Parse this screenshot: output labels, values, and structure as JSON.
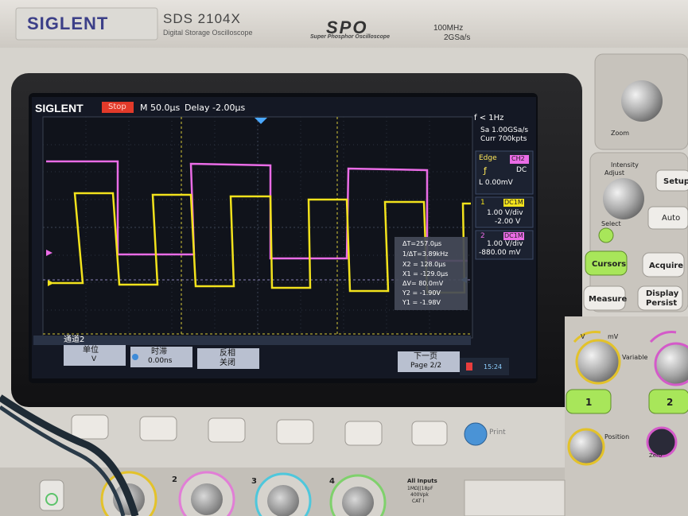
{
  "device": {
    "brand": "SIGLENT",
    "model": "SDS 2104X",
    "model_subtitle": "Digital Storage Oscilloscope",
    "series_logo": "SPO",
    "series_subtitle": "Super Phosphor Oscilloscope",
    "bandwidth": "100MHz",
    "sample_rate": "2GSa/s"
  },
  "screen": {
    "logo": "SIGLENT",
    "run_state": "Stop",
    "timebase": "M 50.0μs",
    "delay": "Delay -2.00μs",
    "freq": "f < 1Hz",
    "sa": "Sa 1.00GSa/s",
    "curr": "Curr 700kpts",
    "trigger": {
      "type": "Edge",
      "source": "CH2",
      "slope_icon": "rising-edge-icon",
      "coupling": "DC",
      "level": "L  0.00mV"
    },
    "ch1": {
      "num": "1",
      "coupling": "DC1M",
      "scale": "1.00 V/div",
      "offset": "-2.00 V"
    },
    "ch2": {
      "num": "2",
      "coupling": "DC1M",
      "scale": "1.00 V/div",
      "offset": "-880.00 mV"
    },
    "cursors": {
      "dt": "ΔT=257.0μs",
      "inv_dt": "1/ΔT=3.89kHz",
      "x2": "X2 = 128.0μs",
      "x1": "X1 = -129.0μs",
      "dv": "ΔV= 80.0mV",
      "y2": "Y2 = -1.90V",
      "y1": "Y1 = -1.98V"
    },
    "menu": {
      "title": "通道2",
      "items": [
        {
          "top": "单位",
          "bottom": "V"
        },
        {
          "top": "时滞",
          "bottom": "0.00ns"
        },
        {
          "top": "反相",
          "bottom": "关闭"
        }
      ],
      "next": {
        "top": "下一页",
        "bottom": "Page 2/2"
      }
    },
    "clock": "15:24"
  },
  "front_panel": {
    "zoom": "Zoom",
    "intensity": "Intensity",
    "adjust": "Adjust",
    "select": "Select",
    "setup": "Setup",
    "auto": "Auto",
    "cursors": "Cursors",
    "acquire": "Acquire",
    "measure": "Measure",
    "display": "Display",
    "persist": "Persist",
    "variable": "Variable",
    "position": "Position",
    "zero": "Zero",
    "ch1_btn": "1",
    "ch2_btn": "2",
    "print": "Print",
    "unit_v": "V",
    "unit_mv": "mV",
    "input_label": "All Inputs",
    "input_spec1": "1MΩ||18pF",
    "input_spec2": "400Vpk",
    "input_spec3": "CAT I",
    "bnc_labels": [
      "2",
      "3",
      "4"
    ]
  },
  "colors": {
    "ch1": "#f2e21c",
    "ch2": "#ea6ce6",
    "accent_green": "#a8e65a",
    "run_state": "#e23a2a",
    "screen_bg": "#141824"
  }
}
